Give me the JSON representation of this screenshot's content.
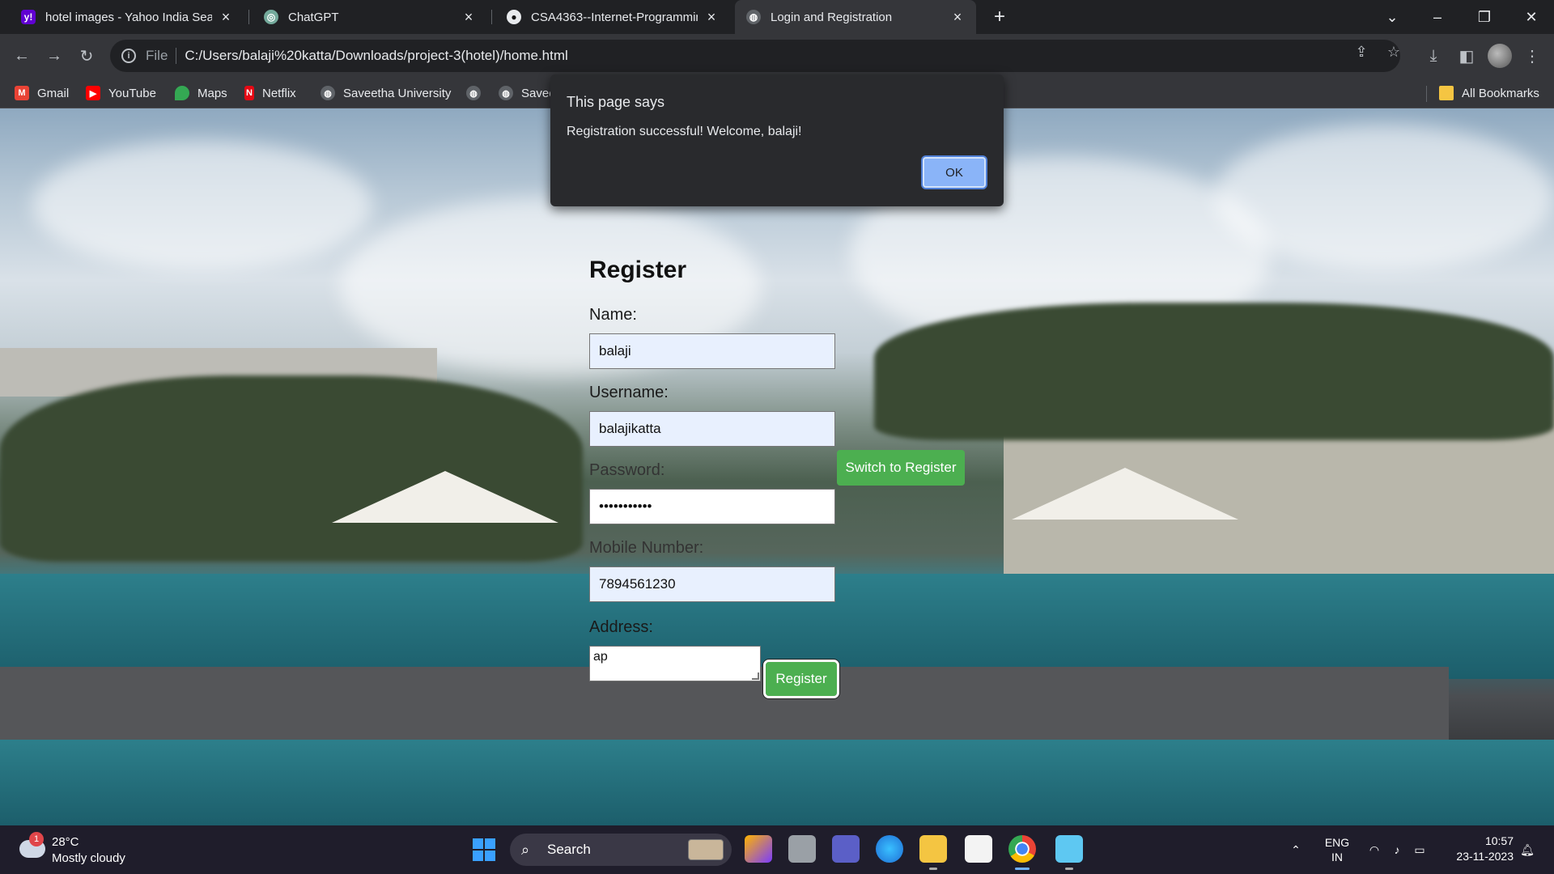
{
  "browser": {
    "tabs": [
      {
        "title": "hotel images - Yahoo India Sear",
        "icon": "yahoo-icon",
        "active": false
      },
      {
        "title": "ChatGPT",
        "icon": "chatgpt-icon",
        "active": false
      },
      {
        "title": "CSA4363--Internet-Programmin",
        "icon": "github-icon",
        "active": false
      },
      {
        "title": "Login and Registration",
        "icon": "globe-icon",
        "active": true
      }
    ],
    "address": {
      "scheme": "File",
      "url": "C:/Users/balaji%20katta/Downloads/project-3(hotel)/home.html"
    },
    "bookmarks": [
      {
        "label": "Gmail",
        "icon": "gmail-icon",
        "color": "#ea4335"
      },
      {
        "label": "YouTube",
        "icon": "youtube-icon",
        "color": "#ff0000"
      },
      {
        "label": "Maps",
        "icon": "maps-icon",
        "color": "#34a853"
      },
      {
        "label": "Netflix",
        "icon": "netflix-icon",
        "color": "#e50914"
      },
      {
        "label": "Saveetha University",
        "icon": "globe-icon",
        "color": "#5f6368"
      },
      {
        "label": "",
        "icon": "globe-icon",
        "color": "#5f6368"
      },
      {
        "label": "Savee",
        "icon": "globe-icon",
        "color": "#5f6368"
      }
    ],
    "all_bookmarks": "All Bookmarks"
  },
  "dialog": {
    "title": "This page says",
    "message": "Registration successful! Welcome, balaji!",
    "ok_label": "OK",
    "ok_color": "#8ab4f8"
  },
  "form": {
    "heading": "Register",
    "name_label": "Name:",
    "name_value": "balaji",
    "username_label": "Username:",
    "username_value": "balajikatta",
    "password_label": "Password:",
    "password_value": "•••••••••••",
    "mobile_label": "Mobile Number:",
    "mobile_value": "7894561230",
    "address_label": "Address:",
    "address_value": "ap",
    "register_button": "Register",
    "switch_button": "Switch to Register",
    "button_color": "#4caf50"
  },
  "taskbar": {
    "weather_temp": "28°C",
    "weather_desc": "Mostly cloudy",
    "weather_badge": "1",
    "search_label": "Search",
    "lang_1": "ENG",
    "lang_2": "IN",
    "time": "10:57",
    "date": "23-11-2023"
  }
}
